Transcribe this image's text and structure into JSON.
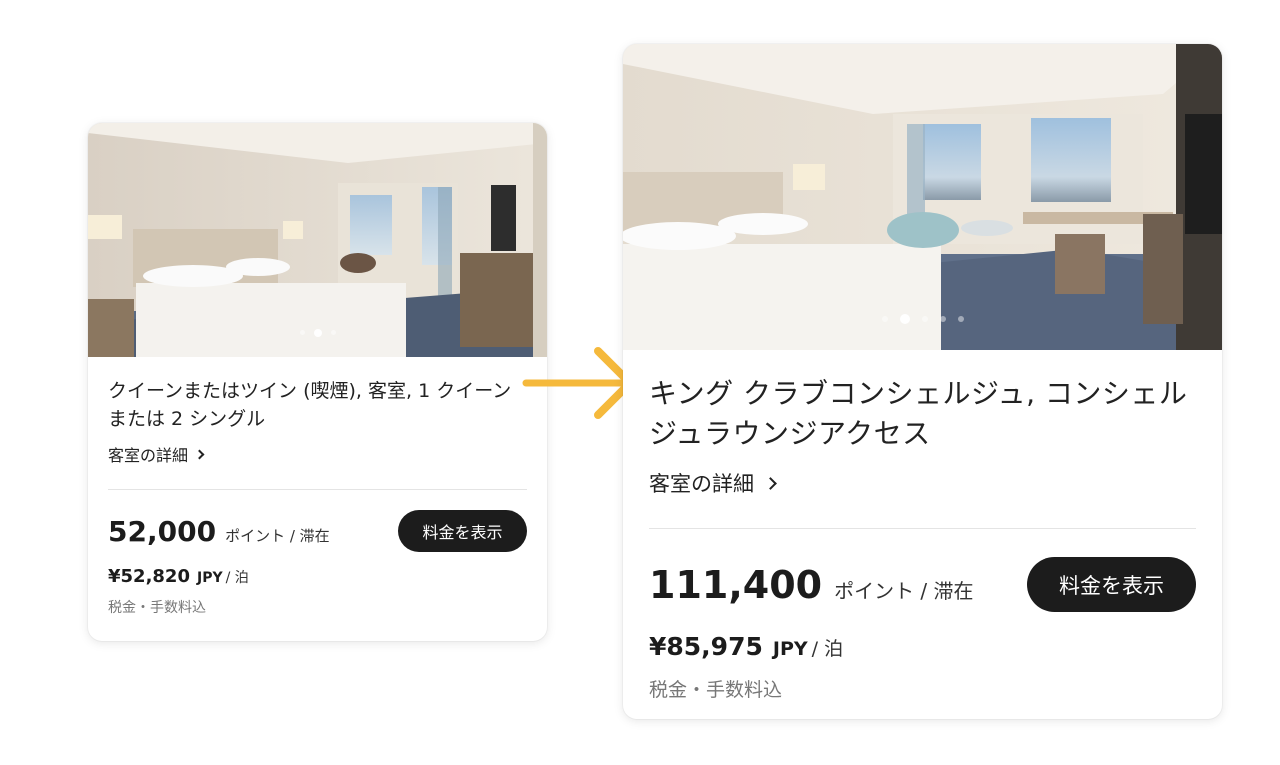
{
  "cards": [
    {
      "title": "クイーンまたはツイン (喫煙), 客室, 1 クイーン または 2 シングル",
      "details_link": "客室の詳細",
      "points": "52,000",
      "points_unit": "ポイント / 滞在",
      "rate_button": "料金を表示",
      "price": "¥52,820",
      "currency": "JPY",
      "per_night": "/ 泊",
      "tax_note": "税金・手数料込",
      "carousel": {
        "total_dots": 3,
        "active_index": 1
      }
    },
    {
      "title": "キング クラブコンシェルジュ, コンシェルジュラウンジアクセス",
      "details_link": "客室の詳細",
      "points": "111,400",
      "points_unit": "ポイント / 滞在",
      "rate_button": "料金を表示",
      "price": "¥85,975",
      "currency": "JPY",
      "per_night": "/ 泊",
      "tax_note": "税金・手数料込",
      "carousel": {
        "total_dots": 5,
        "active_index": 1
      }
    }
  ],
  "colors": {
    "button_bg": "#1c1c1c",
    "arrow": "#f5b93c",
    "divider": "#e4e4e4",
    "muted_text": "#777777"
  }
}
